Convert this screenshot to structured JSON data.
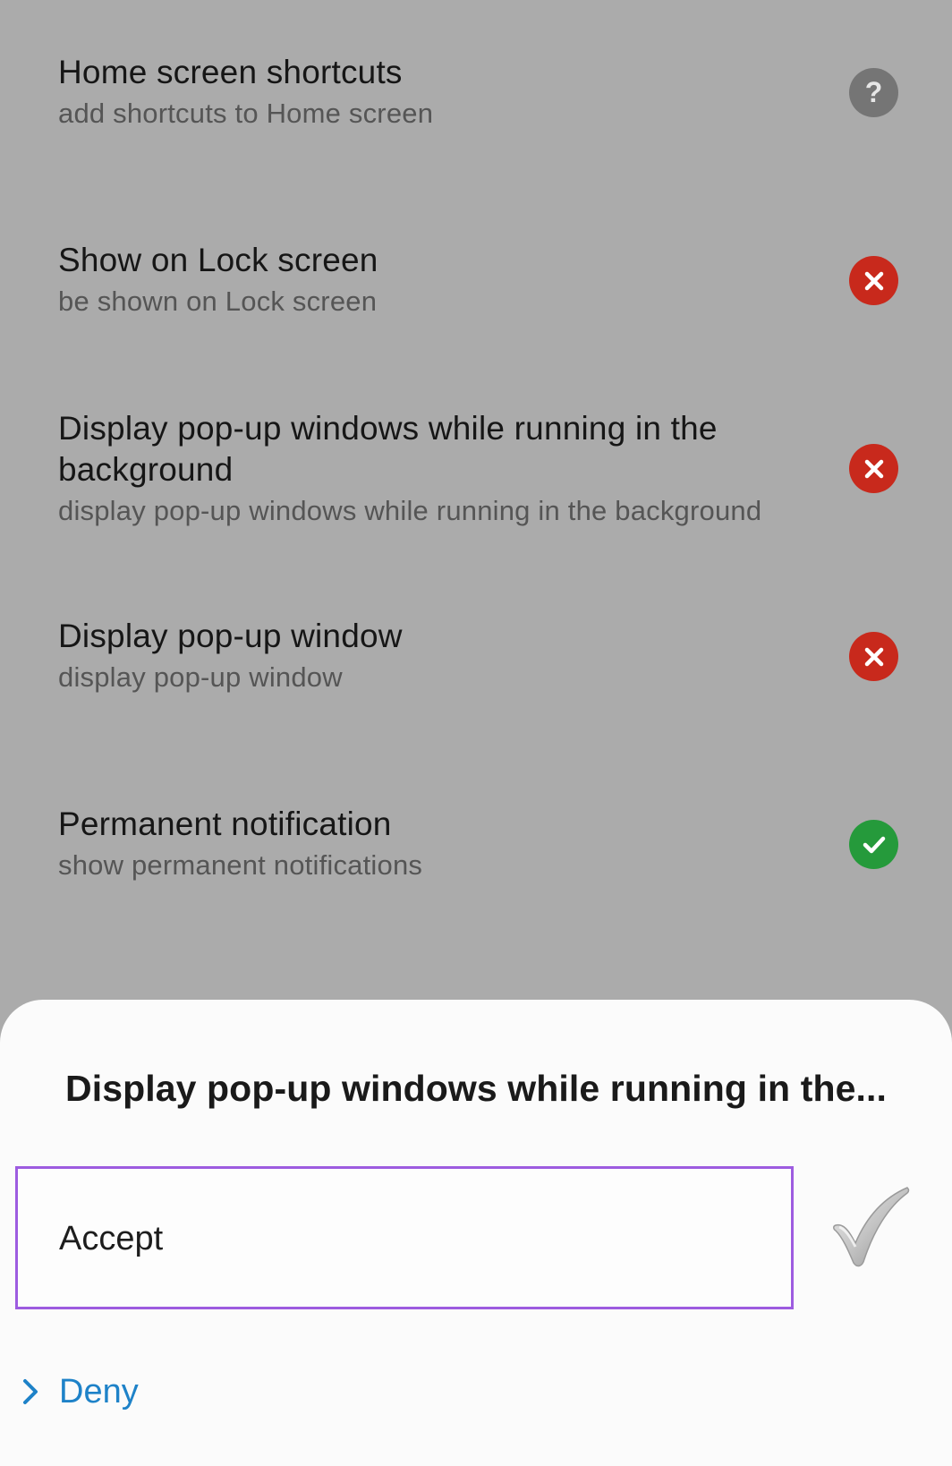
{
  "permissions": [
    {
      "title": "Home screen shortcuts",
      "subtitle": "add shortcuts to Home screen",
      "status": "unknown",
      "icon": "question-icon"
    },
    {
      "title": "Show on Lock screen",
      "subtitle": "be shown on Lock screen",
      "status": "denied",
      "icon": "x-icon"
    },
    {
      "title": "Display pop-up windows while running in the background",
      "subtitle": "display pop-up windows while running in the background",
      "status": "denied",
      "icon": "x-icon"
    },
    {
      "title": "Display pop-up window",
      "subtitle": "display pop-up window",
      "status": "denied",
      "icon": "x-icon"
    },
    {
      "title": "Permanent notification",
      "subtitle": "show permanent notifications",
      "status": "allowed",
      "icon": "check-icon"
    }
  ],
  "sheet": {
    "title": "Display pop-up windows while running in the...",
    "accept_label": "Accept",
    "deny_label": "Deny"
  },
  "colors": {
    "background_dim": "#ababab",
    "denied": "#c8291c",
    "allowed": "#259a3b",
    "unknown": "#757575",
    "selection_border": "#9d5ce0",
    "link": "#1e82c8"
  }
}
